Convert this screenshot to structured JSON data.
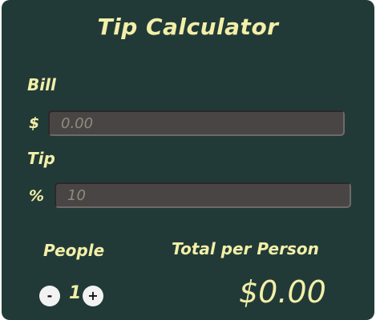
{
  "title": "Tip Calculator",
  "bill": {
    "label": "Bill",
    "prefix": "$",
    "placeholder": "0.00"
  },
  "tip": {
    "label": "Tip",
    "prefix": "%",
    "placeholder": "10"
  },
  "people": {
    "label": "People",
    "decrement": "-",
    "count": "1",
    "increment": "+"
  },
  "total": {
    "label": "Total per Person",
    "value": "$0.00"
  },
  "colors": {
    "background": "#223a37",
    "accent_text": "#f2efa8",
    "field_bg": "#4a4545"
  }
}
